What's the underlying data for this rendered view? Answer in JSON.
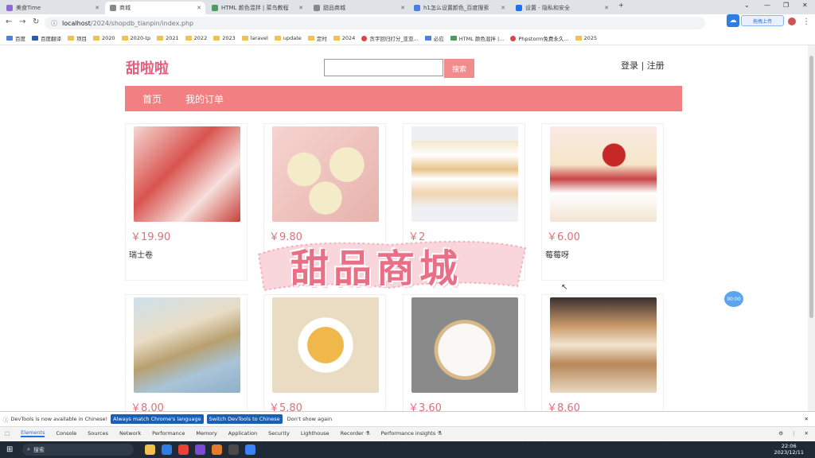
{
  "browser": {
    "tabs": [
      {
        "label": "美食Time",
        "color": "#8e6bd9",
        "active": false
      },
      {
        "label": "商城",
        "color": "#888888",
        "active": true
      },
      {
        "label": "HTML 颜色混拌 | 菜鸟教程",
        "color": "#4a9d5b",
        "active": false
      },
      {
        "label": "甜品商城",
        "color": "#888888",
        "active": false
      },
      {
        "label": "h1怎么设置颜色_百度搜索",
        "color": "#4b7fe0",
        "active": false
      },
      {
        "label": "设置 - 隐私和安全",
        "color": "#1a73e8",
        "active": false
      }
    ],
    "url_host": "localhost",
    "url_path": "/2024/shopdb_tianpin/index.php",
    "upload_label": "拖拽上传",
    "bookmarks": [
      "百度",
      "百度翻译",
      "项目",
      "2020",
      "2020-tp",
      "2021",
      "2022",
      "2023",
      "laravel",
      "update",
      "定时",
      "2024",
      "贪字回归打分_亚亚...",
      "必应",
      "HTML 颜色混拌 |...",
      "Phpstorm免费永久...",
      "2025"
    ]
  },
  "page": {
    "logo": "甜啦啦",
    "search_button": "搜索",
    "search_placeholder": "",
    "login": "登录",
    "separator": "|",
    "register": "注册",
    "nav": [
      "首页",
      "我的订单"
    ],
    "banner": "甜品商城",
    "timer": "00:00"
  },
  "products": [
    {
      "price": "￥19.90",
      "name": "瑞士卷",
      "color": "#d9534f"
    },
    {
      "price": "￥9.80",
      "name": "",
      "color": "#e8d7a8"
    },
    {
      "price": "￥2",
      "name": "",
      "color": "#f3e3c8"
    },
    {
      "price": "￥6.00",
      "name": "莓莓呀",
      "color": "#c94545"
    },
    {
      "price": "￥8.00",
      "name": "",
      "color": "#a8c4d8"
    },
    {
      "price": "￥5.80",
      "name": "",
      "color": "#f0b84a"
    },
    {
      "price": "￥3.60",
      "name": "",
      "color": "#e8e2dc"
    },
    {
      "price": "￥8.60",
      "name": "",
      "color": "#c99a6a"
    }
  ],
  "devtools": {
    "notice": "DevTools is now available in Chinese!",
    "btn_match": "Always match Chrome's language",
    "btn_switch": "Switch DevTools to Chinese",
    "btn_dismiss": "Don't show again",
    "tabs": [
      "Elements",
      "Console",
      "Sources",
      "Network",
      "Performance",
      "Memory",
      "Application",
      "Security",
      "Lighthouse",
      "Recorder ⚗",
      "Performance insights ⚗"
    ]
  },
  "taskbar": {
    "search": "搜索",
    "time": "22:06",
    "date": "2023/12/11"
  }
}
